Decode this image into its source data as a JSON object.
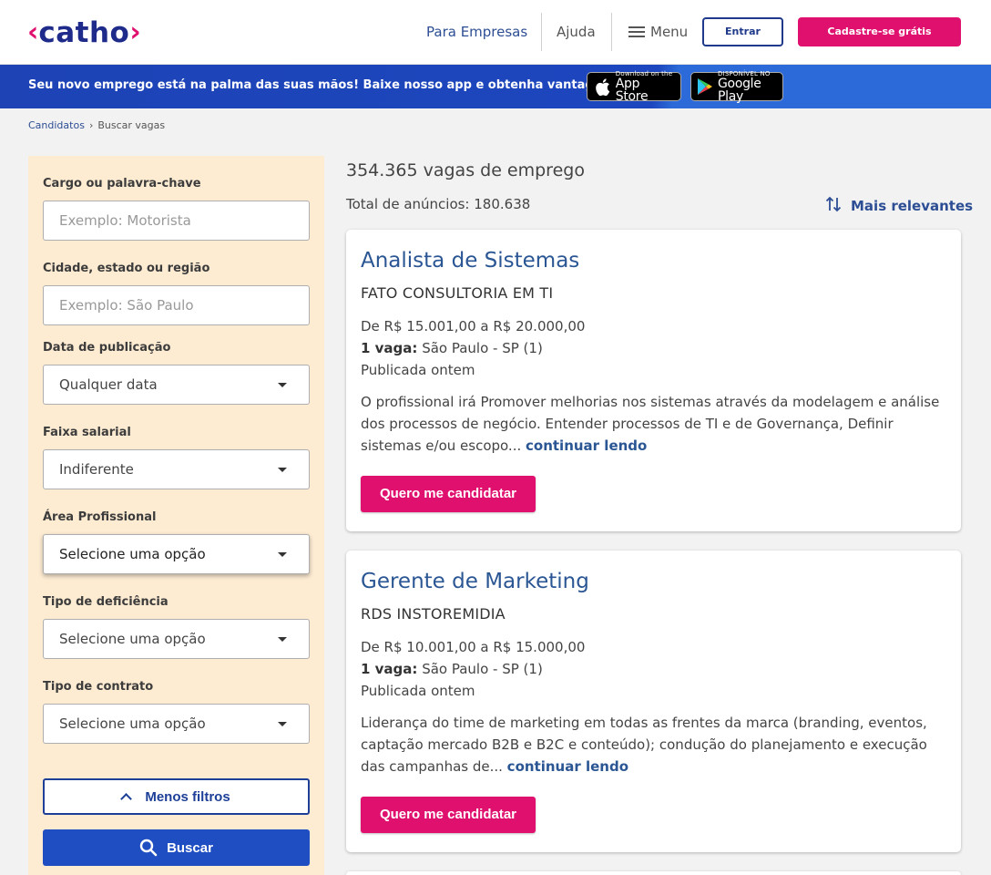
{
  "header": {
    "logo_text": "catho",
    "nav_empresas": "Para Empresas",
    "nav_ajuda": "Ajuda",
    "nav_menu": "Menu",
    "btn_entrar": "Entrar",
    "btn_cadastre": "Cadastre-se grátis"
  },
  "app_banner": {
    "message": "Seu novo emprego está na palma das suas mãos! Baixe nosso app e obtenha vantagens :)",
    "app_store_small": "Download on the",
    "app_store_big": "App Store",
    "google_small": "DISPONÍVEL NO",
    "google_big": "Google Play"
  },
  "breadcrumb": {
    "home": "Candidatos",
    "current": "Buscar vagas"
  },
  "filters": {
    "cargo_label": "Cargo ou palavra-chave",
    "cargo_placeholder": "Exemplo: Motorista",
    "cidade_label": "Cidade, estado ou região",
    "cidade_placeholder": "Exemplo: São Paulo",
    "data_label": "Data de publicação",
    "data_value": "Qualquer data",
    "faixa_label": "Faixa salarial",
    "faixa_value": "Indiferente",
    "area_label": "Área Profissional",
    "area_value": "Selecione uma opção",
    "deficiencia_label": "Tipo de deficiência",
    "deficiencia_value": "Selecione uma opção",
    "contrato_label": "Tipo de contrato",
    "contrato_value": "Selecione uma opção",
    "menos_filtros": "Menos filtros",
    "buscar": "Buscar"
  },
  "results": {
    "count_title": "354.365 vagas de emprego",
    "total": "Total de anúncios: 180.638",
    "sort_label": "Mais relevantes",
    "jobs": [
      {
        "title": "Analista de Sistemas",
        "company": "FATO CONSULTORIA EM TI",
        "salary": "De R$ 15.001,00 a R$ 20.000,00",
        "vaga_bold": "1 vaga:",
        "location": " São Paulo - SP (1)",
        "published": "Publicada ontem",
        "description": "O profissional irá Promover melhorias nos sistemas através da modelagem e análise dos processos de negócio. Entender processos de TI e de Governança, Definir sistemas e/ou escopo... ",
        "more": "continuar lendo",
        "apply": "Quero me candidatar"
      },
      {
        "title": "Gerente de Marketing",
        "company": "RDS INSTOREMIDIA",
        "salary": "De R$ 10.001,00 a R$ 15.000,00",
        "vaga_bold": "1 vaga:",
        "location": " São Paulo - SP (1)",
        "published": "Publicada ontem",
        "description": "Liderança do time de marketing em todas as frentes da marca (branding, eventos, captação mercado B2B e B2C e conteúdo); condução do planejamento e execução das campanhas de... ",
        "more": "continuar lendo",
        "apply": "Quero me candidatar"
      }
    ]
  },
  "colors": {
    "brand_pink": "#e0106f",
    "brand_blue": "#1f2b8a",
    "filter_bg": "#fdebd2",
    "link_blue": "#2b5694"
  }
}
